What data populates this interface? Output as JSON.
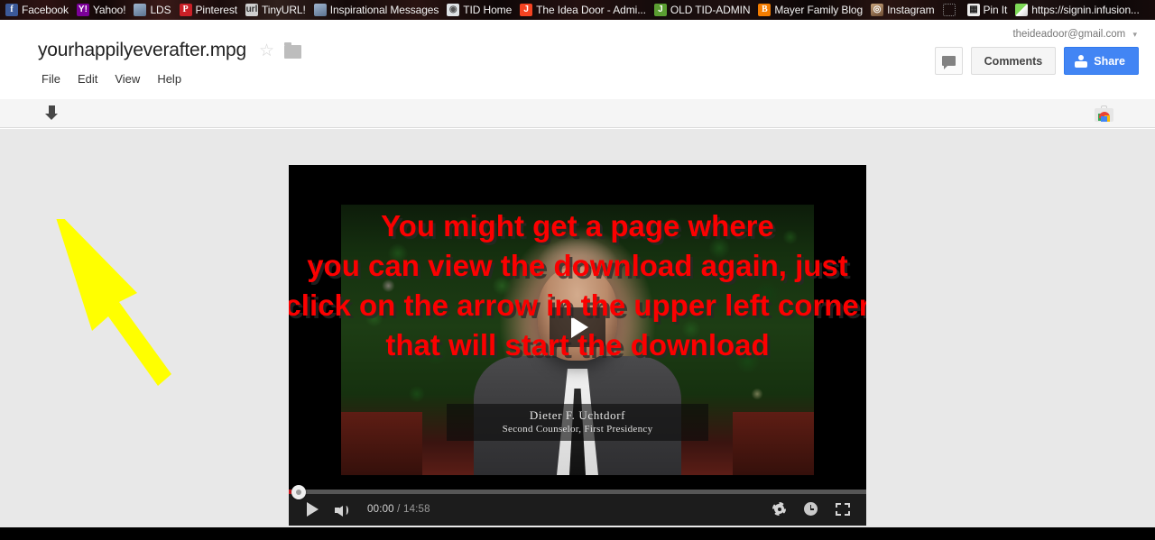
{
  "bookmarks": [
    {
      "label": "Facebook",
      "icon": "facebook-icon",
      "glyph": "f"
    },
    {
      "label": "Yahoo!",
      "icon": "yahoo-icon",
      "glyph": "Y!"
    },
    {
      "label": "LDS",
      "icon": "lds-icon",
      "glyph": ""
    },
    {
      "label": "Pinterest",
      "icon": "pinterest-icon",
      "glyph": "P"
    },
    {
      "label": "TinyURL!",
      "icon": "tinyurl-icon",
      "glyph": ""
    },
    {
      "label": "Inspirational Messages",
      "icon": "inspirational-messages-icon",
      "glyph": ""
    },
    {
      "label": "TID Home",
      "icon": "tid-home-icon",
      "glyph": ""
    },
    {
      "label": "The Idea Door - Admi...",
      "icon": "joomla-icon",
      "glyph": "J"
    },
    {
      "label": "OLD TID-ADMIN",
      "icon": "joomla-green-icon",
      "glyph": "J"
    },
    {
      "label": "Mayer Family Blog",
      "icon": "blogger-icon",
      "glyph": "B"
    },
    {
      "label": "Instagram",
      "icon": "instagram-icon",
      "glyph": ""
    },
    {
      "label": "",
      "icon": "empty-bookmark-icon",
      "glyph": ""
    },
    {
      "label": "Pin It",
      "icon": "pin-it-icon",
      "glyph": ""
    },
    {
      "label": "https://signin.infusion...",
      "icon": "infusionsoft-icon",
      "glyph": ""
    }
  ],
  "header": {
    "doc_title": "yourhappilyeverafter.mpg",
    "star_glyph": "☆",
    "menus": [
      {
        "label": "File"
      },
      {
        "label": "Edit"
      },
      {
        "label": "View"
      },
      {
        "label": "Help"
      }
    ],
    "account_email": "theideadoor@gmail.com",
    "account_caret": "▾",
    "comments_label": "Comments",
    "share_label": "Share"
  },
  "toolbar": {
    "download_icon": "download-icon",
    "open_with_icon": "open-with-app-icon"
  },
  "annotation": {
    "text_color": "#fc0000",
    "arrow_color": "#ffff00",
    "lines": [
      "You might get a page where",
      "you can view the download again, just",
      "click on the arrow in the upper left corner",
      "that will start the download"
    ]
  },
  "video": {
    "caption_name": "Dieter F. Uchtdorf",
    "caption_role": "Second Counselor, First Presidency",
    "current_time": "00:00",
    "time_separator": " / ",
    "duration": "14:58",
    "play_button": "play-button",
    "volume_button": "volume-button",
    "settings_button": "settings-gear-button",
    "info_button": "info-button",
    "fullscreen_button": "fullscreen-button",
    "progress_percent": 0
  },
  "colors": {
    "accent_blue": "#4285f4",
    "annotation_red": "#fc0000",
    "annotation_yellow": "#ffff00",
    "page_background": "#e8e8e8",
    "toolbar_background": "#f5f5f5"
  }
}
